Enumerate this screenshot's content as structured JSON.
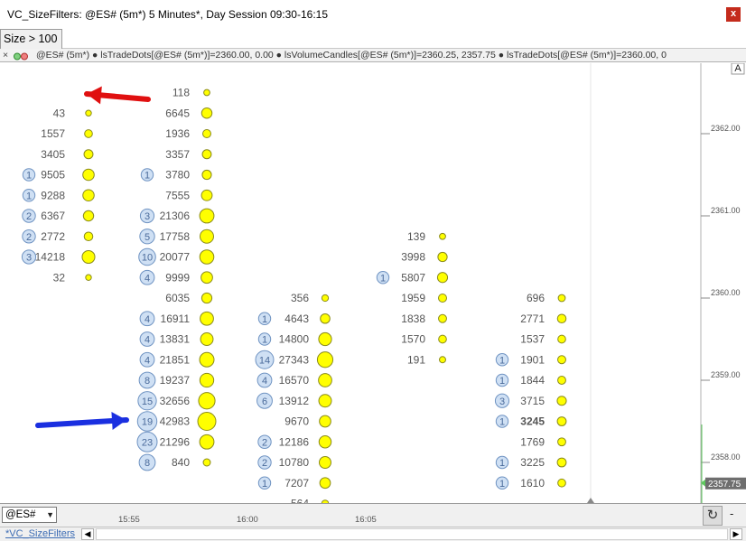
{
  "window": {
    "title": "VC_SizeFilters: @ES# (5m*) 5 Minutes*, Day Session 09:30-16:15",
    "close_label": "x"
  },
  "tab": {
    "label": "Size > 100"
  },
  "legend": {
    "close": "×",
    "text": "@ES# (5m*) ● lsTradeDots[@ES# (5m*)]=2360.00, 0.00 ● lsVolumeCandles[@ES# (5m*)]=2360.25, 2357.75 ● lsTradeDots[@ES# (5m*)]=2360.00, 0"
  },
  "axis": {
    "scale_label": "A",
    "y_ticks": [
      "2362.00",
      "2361.00",
      "2360.00",
      "2359.00",
      "2358.00"
    ],
    "last_price": "2357.75"
  },
  "bottom": {
    "symbol": "@ES#",
    "arrow": "▼",
    "times": [
      "15:55",
      "16:00",
      "16:05"
    ],
    "refresh": "↻",
    "minus": "-"
  },
  "sheet": {
    "tab": "*VC_SizeFilters",
    "prev": "◀",
    "next": "▶"
  },
  "colors": {
    "dot_fill": "#ffff00",
    "dot_stroke": "#8a8a1a",
    "count_fill": "#cfe0f4",
    "count_stroke": "#6f93c2",
    "text": "#555555",
    "red_arrow": "#e01010",
    "blue_arrow": "#1a2fe0"
  },
  "chart_data": {
    "type": "scatter",
    "title": "",
    "y_ticks": [
      2362.0,
      2361.0,
      2360.0,
      2359.0,
      2358.0
    ],
    "ylim": [
      2357.5,
      2362.75
    ],
    "x_ticks": [
      "15:55",
      "16:00",
      "16:05"
    ],
    "columns": [
      {
        "bar": 1,
        "entries": [
          {
            "price": 2362.25,
            "volume": 43
          },
          {
            "price": 2362.0,
            "volume": 1557
          },
          {
            "price": 2361.75,
            "volume": 3405
          },
          {
            "price": 2361.5,
            "volume": 9505,
            "count": 1
          },
          {
            "price": 2361.25,
            "volume": 9288,
            "count": 1
          },
          {
            "price": 2361.0,
            "volume": 6367,
            "count": 2
          },
          {
            "price": 2360.75,
            "volume": 2772,
            "count": 2
          },
          {
            "price": 2360.5,
            "volume": 14218,
            "count": 3
          },
          {
            "price": 2360.25,
            "volume": 32
          }
        ]
      },
      {
        "bar": 2,
        "entries": [
          {
            "price": 2362.5,
            "volume": 118
          },
          {
            "price": 2362.25,
            "volume": 6645
          },
          {
            "price": 2362.0,
            "volume": 1936
          },
          {
            "price": 2361.75,
            "volume": 3357
          },
          {
            "price": 2361.5,
            "volume": 3780,
            "count": 1
          },
          {
            "price": 2361.25,
            "volume": 7555
          },
          {
            "price": 2361.0,
            "volume": 21306,
            "count": 3
          },
          {
            "price": 2360.75,
            "volume": 17758,
            "count": 5
          },
          {
            "price": 2360.5,
            "volume": 20077,
            "count": 10
          },
          {
            "price": 2360.25,
            "volume": 9999,
            "count": 4
          },
          {
            "price": 2360.0,
            "volume": 6035
          },
          {
            "price": 2359.75,
            "volume": 16911,
            "count": 4
          },
          {
            "price": 2359.5,
            "volume": 13831,
            "count": 4
          },
          {
            "price": 2359.25,
            "volume": 21851,
            "count": 4
          },
          {
            "price": 2359.0,
            "volume": 19237,
            "count": 8
          },
          {
            "price": 2358.75,
            "volume": 32656,
            "count": 15
          },
          {
            "price": 2358.5,
            "volume": 42983,
            "count": 19
          },
          {
            "price": 2358.25,
            "volume": 21296,
            "count": 23
          },
          {
            "price": 2358.0,
            "volume": 840,
            "count": 8
          }
        ]
      },
      {
        "bar": 3,
        "entries": [
          {
            "price": 2360.0,
            "volume": 356
          },
          {
            "price": 2359.75,
            "volume": 4643,
            "count": 1
          },
          {
            "price": 2359.5,
            "volume": 14800,
            "count": 1
          },
          {
            "price": 2359.25,
            "volume": 27343,
            "count": 14
          },
          {
            "price": 2359.0,
            "volume": 16570,
            "count": 4
          },
          {
            "price": 2358.75,
            "volume": 13912,
            "count": 6
          },
          {
            "price": 2358.5,
            "volume": 9670
          },
          {
            "price": 2358.25,
            "volume": 12186,
            "count": 2
          },
          {
            "price": 2358.0,
            "volume": 10780,
            "count": 2
          },
          {
            "price": 2357.75,
            "volume": 7207,
            "count": 1
          },
          {
            "price": 2357.5,
            "volume": 564
          }
        ]
      },
      {
        "bar": 4,
        "entries": [
          {
            "price": 2360.75,
            "volume": 139
          },
          {
            "price": 2360.5,
            "volume": 3998
          },
          {
            "price": 2360.25,
            "volume": 5807,
            "count": 1
          },
          {
            "price": 2360.0,
            "volume": 1959
          },
          {
            "price": 2359.75,
            "volume": 1838
          },
          {
            "price": 2359.5,
            "volume": 1570
          },
          {
            "price": 2359.25,
            "volume": 191
          }
        ]
      },
      {
        "bar": 5,
        "entries": [
          {
            "price": 2360.0,
            "volume": 696
          },
          {
            "price": 2359.75,
            "volume": 2771
          },
          {
            "price": 2359.5,
            "volume": 1537
          },
          {
            "price": 2359.25,
            "volume": 1901,
            "count": 1
          },
          {
            "price": 2359.0,
            "volume": 1844,
            "count": 1
          },
          {
            "price": 2358.75,
            "volume": 3715,
            "count": 3
          },
          {
            "price": 2358.5,
            "volume": 3245,
            "count": 1,
            "bold": true
          },
          {
            "price": 2358.25,
            "volume": 1769
          },
          {
            "price": 2358.0,
            "volume": 3225,
            "count": 1
          },
          {
            "price": 2357.75,
            "volume": 1610,
            "count": 1
          }
        ]
      }
    ],
    "annotations": [
      {
        "type": "arrow",
        "color": "red",
        "points_to": {
          "bar": 1,
          "price": 2362.25
        }
      },
      {
        "type": "arrow",
        "color": "blue",
        "points_to": {
          "bar": 2,
          "price": 2358.25
        }
      }
    ]
  }
}
